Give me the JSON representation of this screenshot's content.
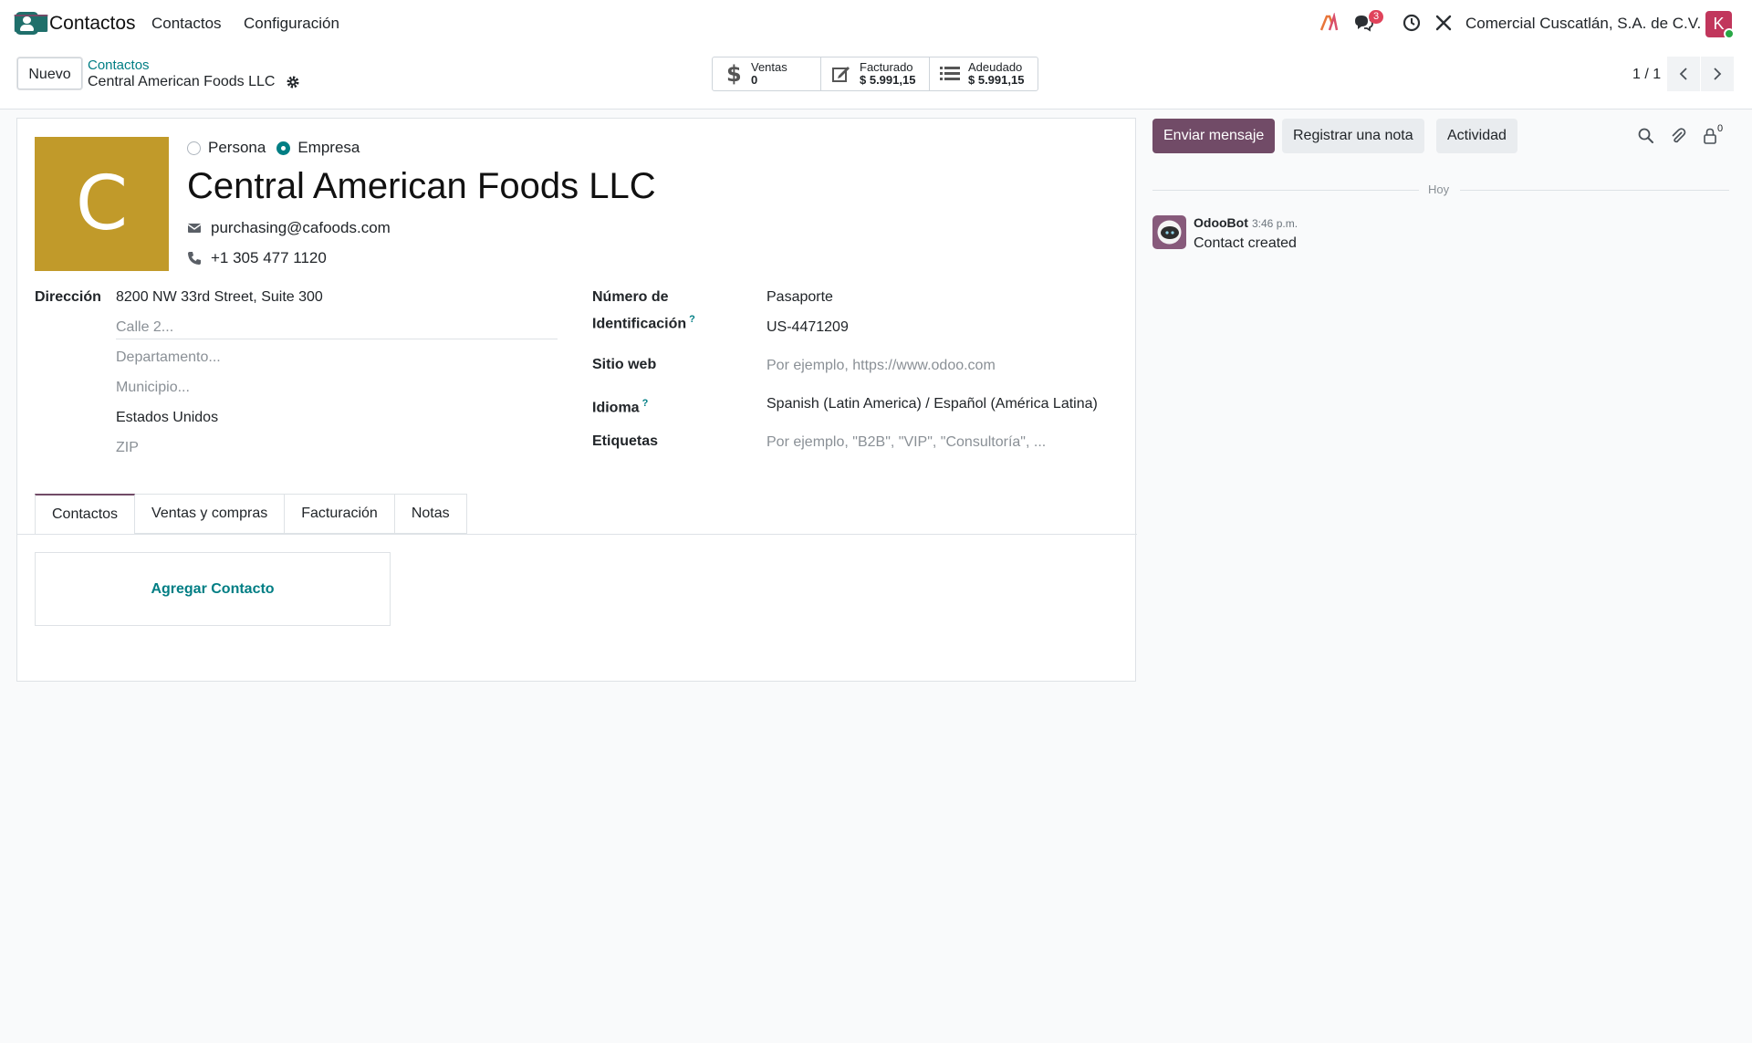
{
  "navbar": {
    "app_name": "Contactos",
    "menu": [
      "Contactos",
      "Configuración"
    ],
    "messages_badge": "3",
    "company": "Comercial Cuscatlán, S.A. de C.V.",
    "user_initial": "K"
  },
  "control_panel": {
    "new_button": "Nuevo",
    "breadcrumb_parent": "Contactos",
    "breadcrumb_current": "Central American Foods LLC",
    "stats": [
      {
        "label": "Ventas",
        "value": "0",
        "icon": "dollar-icon"
      },
      {
        "label": "Facturado",
        "value": "$ 5.991,15",
        "icon": "invoice-edit-icon"
      },
      {
        "label": "Adeudado",
        "value": "$ 5.991,15",
        "icon": "list-icon"
      }
    ],
    "pager": "1 / 1"
  },
  "form": {
    "avatar_letter": "C",
    "type_options": [
      "Persona",
      "Empresa"
    ],
    "type_selected": "Empresa",
    "name": "Central American Foods LLC",
    "email": "purchasing@cafoods.com",
    "phone": "+1 305 477 1120",
    "address": {
      "label": "Dirección",
      "street": "8200 NW 33rd Street, Suite 300",
      "street2_placeholder": "Calle 2...",
      "state_placeholder": "Departamento...",
      "city_placeholder": "Municipio...",
      "country": "Estados Unidos",
      "zip_placeholder": "ZIP"
    },
    "id_number": {
      "label_line1": "Número de",
      "label_line2": "Identificación",
      "help": "?",
      "type": "Pasaporte",
      "value": "US-4471209"
    },
    "website": {
      "label": "Sitio web",
      "placeholder": "Por ejemplo, https://www.odoo.com"
    },
    "language": {
      "label": "Idioma",
      "help": "?",
      "value": "Spanish (Latin America) / Español (América Latina)"
    },
    "tags": {
      "label": "Etiquetas",
      "placeholder": "Por ejemplo, \"B2B\", \"VIP\", \"Consultoría\", ..."
    },
    "tabs": [
      "Contactos",
      "Ventas y compras",
      "Facturación",
      "Notas"
    ],
    "active_tab": "Contactos",
    "add_contact": "Agregar Contacto"
  },
  "chatter": {
    "send_message": "Enviar mensaje",
    "log_note": "Registrar una nota",
    "activity": "Actividad",
    "followers_count": "0",
    "date_separator": "Hoy",
    "messages": [
      {
        "author": "OdooBot",
        "time": "3:46 p.m.",
        "body": "Contact created"
      }
    ]
  },
  "colors": {
    "brand": "#714b67",
    "link": "#017e84",
    "avatar": "#c19a2a",
    "badge": "#e0435b"
  }
}
